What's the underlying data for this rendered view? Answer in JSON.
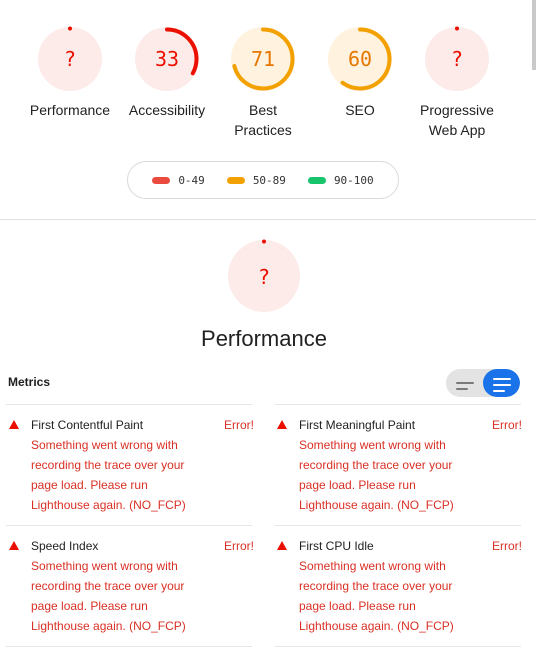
{
  "gauges": [
    {
      "label": "Performance",
      "score": "?",
      "value": null,
      "color": "#eb0f00"
    },
    {
      "label": "Accessibility",
      "score": "33",
      "value": 0.33,
      "color": "#eb0f00"
    },
    {
      "label": "Best Practices",
      "label_line1": "Best",
      "label_line2": "Practices",
      "score": "71",
      "value": 0.71,
      "color": "#e67700"
    },
    {
      "label": "SEO",
      "score": "60",
      "value": 0.6,
      "color": "#e67700"
    },
    {
      "label": "Progressive Web App",
      "label_line1": "Progressive",
      "label_line2": "Web App",
      "score": "?",
      "value": null,
      "color": "#eb0f00"
    }
  ],
  "legend": [
    {
      "range": "0-49",
      "color": "#eb4b3f"
    },
    {
      "range": "50-89",
      "color": "#f2a100"
    },
    {
      "range": "90-100",
      "color": "#17c46b"
    }
  ],
  "performance": {
    "score": "?",
    "title": "Performance"
  },
  "metrics": {
    "header": "Metrics",
    "items": [
      {
        "name": "First Contentful Paint",
        "status": "Error!",
        "message": "Something went wrong with recording the trace over your page load. Please run Lighthouse again. (NO_FCP)"
      },
      {
        "name": "First Meaningful Paint",
        "status": "Error!",
        "message": "Something went wrong with recording the trace over your page load. Please run Lighthouse again. (NO_FCP)"
      },
      {
        "name": "Speed Index",
        "status": "Error!",
        "message": "Something went wrong with recording the trace over your page load. Please run Lighthouse again. (NO_FCP)"
      },
      {
        "name": "First CPU Idle",
        "status": "Error!",
        "message": "Something went wrong with recording the trace over your page load. Please run Lighthouse again. (NO_FCP)"
      }
    ]
  },
  "colors": {
    "fail": "#eb0f00",
    "average": "#e67700",
    "fail_bg": "#fdebea",
    "average_bg": "#fff3e0",
    "toggle_active": "#1a73e8"
  }
}
